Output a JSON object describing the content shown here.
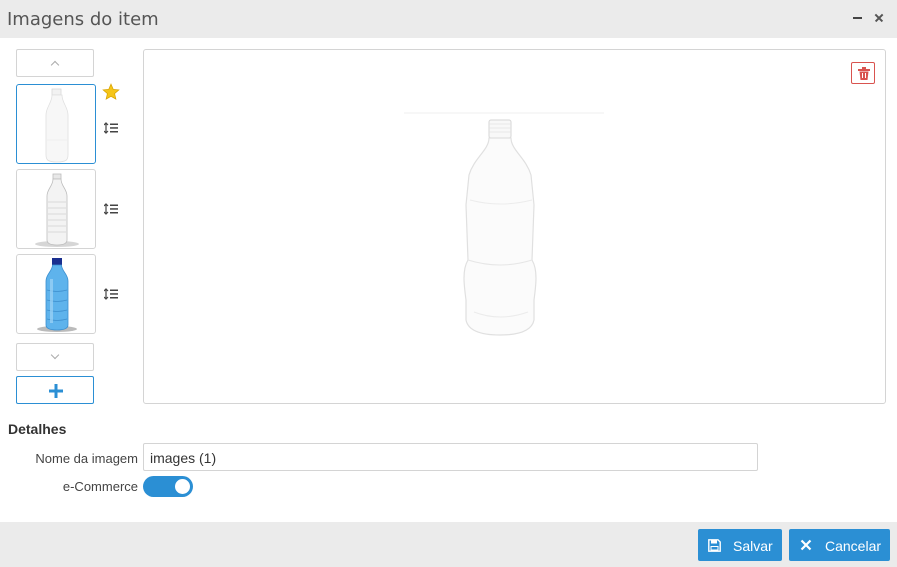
{
  "window": {
    "title": "Imagens do item"
  },
  "thumbnails": [
    {
      "name": "thumbnail-clear-bottle-2l",
      "selected": true,
      "starred": true
    },
    {
      "name": "thumbnail-clear-bottle-ribbed",
      "selected": false,
      "starred": false
    },
    {
      "name": "thumbnail-blue-bottle",
      "selected": false,
      "starred": false
    }
  ],
  "details": {
    "heading": "Detalhes",
    "image_name_label": "Nome da imagem",
    "image_name_value": "images (1)",
    "ecommerce_label": "e-Commerce",
    "ecommerce_enabled": true
  },
  "footer": {
    "save_label": "Salvar",
    "cancel_label": "Cancelar"
  },
  "colors": {
    "accent": "#2b8fd4",
    "delete": "#d9534f",
    "star": "#f5c518",
    "titlebar": "#ebebeb"
  },
  "icons": [
    "minimize-icon",
    "close-icon",
    "chevron-up-icon",
    "chevron-down-icon",
    "plus-icon",
    "star-icon",
    "reorder-icon",
    "trash-icon",
    "floppy-disk-icon",
    "x-icon"
  ]
}
